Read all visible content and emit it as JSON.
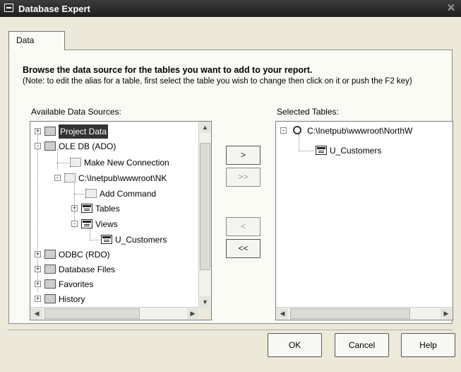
{
  "window": {
    "title": "Database Expert",
    "close_glyph": "✕",
    "system_icon": "window-menu-icon"
  },
  "tabs": [
    {
      "label": "Data"
    }
  ],
  "panel": {
    "intro": "Browse the data source for the tables you want to add to your report.",
    "note": "(Note: to edit the alias for a table, first select the table you wish to change then click on it or push the F2 key)",
    "available_label": "Available Data Sources:",
    "selected_label": "Selected Tables:"
  },
  "available_tree": [
    {
      "label": "Project Data",
      "icon": "folder-icon",
      "expander": "+",
      "selected": true
    },
    {
      "label": "OLE DB (ADO)",
      "icon": "folder-icon",
      "expander": "-"
    },
    {
      "label": "Make New Connection",
      "icon": "connection-icon"
    },
    {
      "label": "C:\\Inetpub\\wwwroot\\NK",
      "icon": "connection-icon",
      "expander": "-"
    },
    {
      "label": "Add Command",
      "icon": "command-icon"
    },
    {
      "label": "Tables",
      "icon": "table-icon",
      "expander": "+"
    },
    {
      "label": "Views",
      "icon": "table-icon",
      "expander": "-"
    },
    {
      "label": "U_Customers",
      "icon": "table-icon"
    },
    {
      "label": "ODBC (RDO)",
      "icon": "folder-icon",
      "expander": "+"
    },
    {
      "label": "Database Files",
      "icon": "folder-icon",
      "expander": "+"
    },
    {
      "label": "Favorites",
      "icon": "folder-icon",
      "expander": "+"
    },
    {
      "label": "History",
      "icon": "folder-icon",
      "expander": "+"
    }
  ],
  "selected_tree": [
    {
      "label": "C:\\Inetpub\\wwwroot\\NorthW",
      "icon": "database-icon",
      "expander": "-"
    },
    {
      "label": "U_Customers",
      "icon": "table-icon"
    }
  ],
  "move_buttons": {
    "add_one": ">",
    "add_all": ">>",
    "remove_one": "<",
    "remove_all": "<<"
  },
  "scroll": {
    "up": "▲",
    "down": "▼",
    "left": "◀",
    "right": "▶"
  },
  "footer_buttons": {
    "ok": "OK",
    "cancel": "Cancel",
    "help": "Help"
  }
}
